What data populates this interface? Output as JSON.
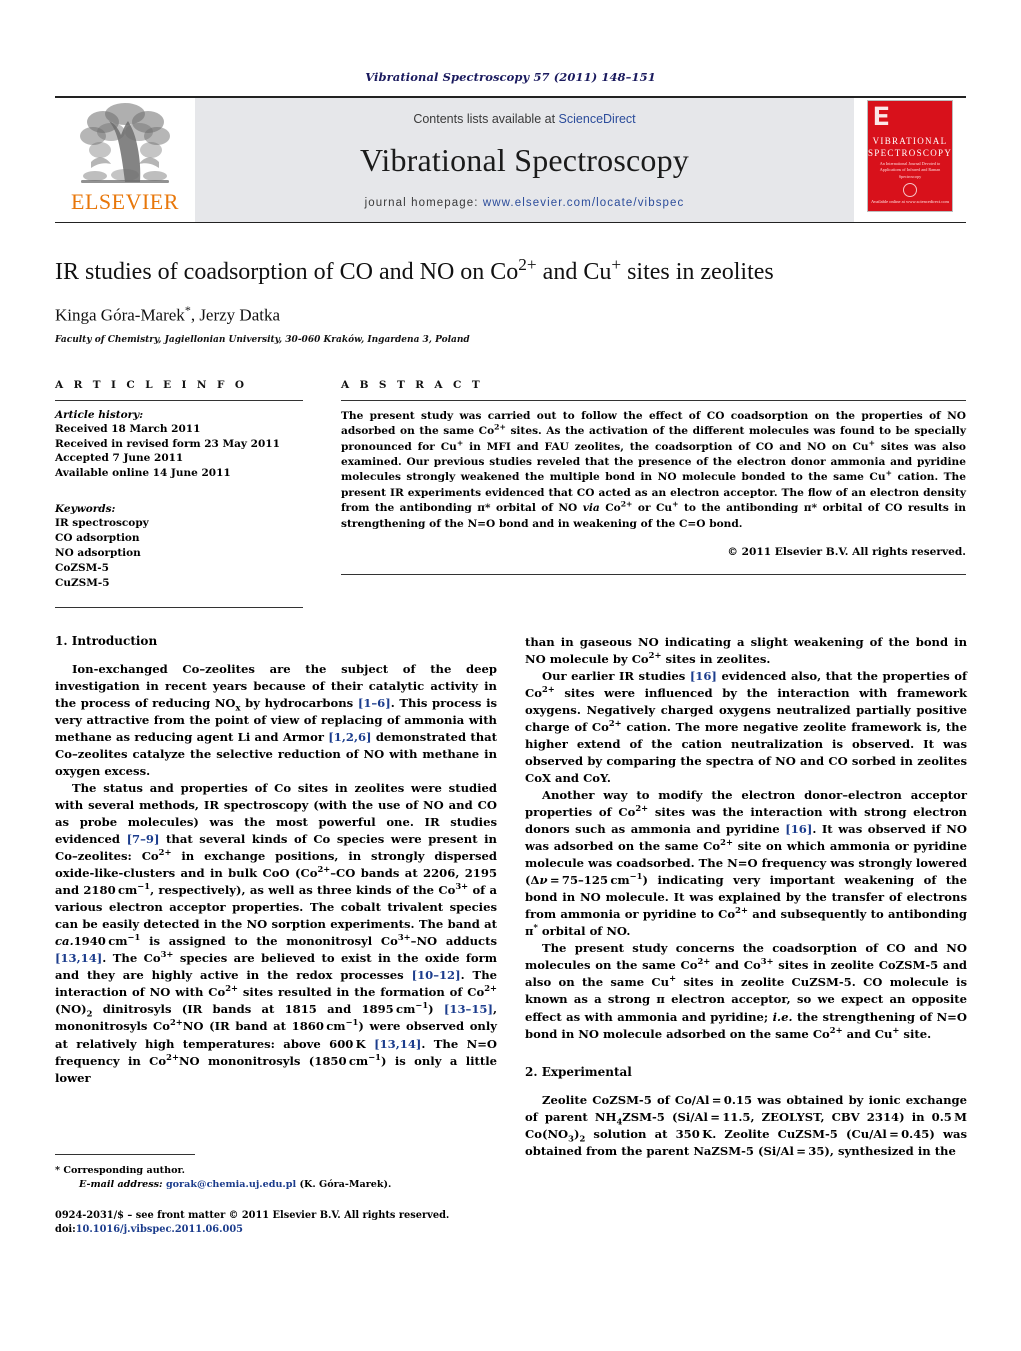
{
  "running_head": "Vibrational Spectroscopy 57 (2011) 148–151",
  "masthead": {
    "contents_prefix": "Contents lists available at",
    "contents_link": "ScienceDirect",
    "journal_title": "Vibrational Spectroscopy",
    "homepage_label": "journal homepage:",
    "homepage_url": "www.elsevier.com/locate/vibspec",
    "publisher_wordmark": "ELSEVIER",
    "cover": {
      "title_line1": "VIBRATIONAL",
      "title_line2": "SPECTROSCOPY",
      "subtitle": "An International Journal Devoted to Applications of Infrared and Raman Spectroscopy",
      "footer": "Available online at www.sciencedirect.com"
    }
  },
  "article": {
    "title": "IR studies of coadsorption of CO and NO on Co2+ and Cu+ sites in zeolites",
    "title_parts": {
      "p1": "IR studies of coadsorption of CO and NO on Co",
      "sup1": "2+",
      "p2": " and Cu",
      "sup2": "+",
      "p3": " sites in zeolites"
    },
    "authors": "Kinga Góra-Marek*, Jerzy Datka",
    "author_names": "Kinga Góra-Marek",
    "author_second": ", Jerzy Datka",
    "affiliation": "Faculty of Chemistry, Jagiellonian University, 30-060 Kraków, Ingardena 3, Poland"
  },
  "info": {
    "heading": "A R T I C L E   I N F O",
    "history_label": "Article history:",
    "history": [
      "Received 18 March 2011",
      "Received in revised form 23 May 2011",
      "Accepted 7 June 2011",
      "Available online 14 June 2011"
    ],
    "keywords_label": "Keywords:",
    "keywords": [
      "IR spectroscopy",
      "CO adsorption",
      "NO adsorption",
      "CoZSM-5",
      "CuZSM-5"
    ]
  },
  "abstract": {
    "heading": "A B S T R A C T",
    "text": "The present study was carried out to follow the effect of CO coadsorption on the properties of NO adsorbed on the same Co2+ sites. As the activation of the different molecules was found to be specially pronounced for Cu+ in MFI and FAU zeolites, the coadsorption of CO and NO on Cu+ sites was also examined. Our previous studies reveled that the presence of the electron donor ammonia and pyridine molecules strongly weakened the multiple bond in NO molecule bonded to the same Cu+ cation. The present IR experiments evidenced that CO acted as an electron acceptor. The flow of an electron density from the antibonding π* orbital of NO via Co2+ or Cu+ to the antibonding π* orbital of CO results in strengthening of the N=O bond and in weakening of the C=O bond.",
    "copyright": "© 2011 Elsevier B.V. All rights reserved."
  },
  "sections": {
    "introduction_heading": "1.  Introduction",
    "experimental_heading": "2.  Experimental"
  },
  "body": {
    "intro_p1": "Ion-exchanged Co–zeolites are the subject of the deep investigation in recent years because of their catalytic activity in the process of reducing NOx by hydrocarbons [1–6]. This process is very attractive from the point of view of replacing of ammonia with methane as reducing agent Li and Armor [1,2,6] demonstrated that Co–zeolites catalyze the selective reduction of NO with methane in oxygen excess.",
    "intro_p2": "The status and properties of Co sites in zeolites were studied with several methods, IR spectroscopy (with the use of NO and CO as probe molecules) was the most powerful one. IR studies evidenced [7–9] that several kinds of Co species were present in Co–zeolites: Co2+ in exchange positions, in strongly dispersed oxide-like-clusters and in bulk CoO (Co2+–CO bands at 2206, 2195 and 2180 cm−1, respectively), as well as three kinds of the Co3+ of a various electron acceptor properties. The cobalt trivalent species can be easily detected in the NO sorption experiments. The band at ca.1940 cm−1 is assigned to the mononitrosyl Co3+–NO adducts [13,14]. The Co3+ species are believed to exist in the oxide form and they are highly active in the redox processes [10–12]. The interaction of NO with Co2+ sites resulted in the formation of Co2+(NO)2 dinitrosyls (IR bands at 1815 and 1895 cm−1) [13–15], mononitrosyls Co2+NO (IR band at 1860 cm−1) were observed only at relatively high temperatures: above 600 K [13,14]. The N=O frequency in Co2+NO mononitrosyls (1850 cm−1) is only a little lower",
    "right_p1": "than in gaseous NO indicating a slight weakening of the bond in NO molecule by Co2+ sites in zeolites.",
    "right_p2": "Our earlier IR studies [16] evidenced also, that the properties of Co2+ sites were influenced by the interaction with framework oxygens. Negatively charged oxygens neutralized partially positive charge of Co2+ cation. The more negative zeolite framework is, the higher extend of the cation neutralization is observed. It was observed by comparing the spectra of NO and CO sorbed in zeolites CoX and CoY.",
    "right_p3": "Another way to modify the electron donor–electron acceptor properties of Co2+ sites was the interaction with strong electron donors such as ammonia and pyridine [16]. It was observed if NO was adsorbed on the same Co2+ site on which ammonia or pyridine molecule was coadsorbed. The N=O frequency was strongly lowered (Δν = 75–125 cm−1) indicating very important weakening of the bond in NO molecule. It was explained by the transfer of electrons from ammonia or pyridine to Co2+ and subsequently to antibonding π* orbital of NO.",
    "right_p4": "The present study concerns the coadsorption of CO and NO molecules on the same Co2+ and Co3+ sites in zeolite CoZSM-5 and also on the same Cu+ sites in zeolite CuZSM-5. CO molecule is known as a strong π electron acceptor, so we expect an opposite effect as with ammonia and pyridine; i.e. the strengthening of N=O bond in NO molecule adsorbed on the same Co2+ and Cu+ site.",
    "exp_p1": "Zeolite CoZSM-5 of Co/Al = 0.15 was obtained by ionic exchange of parent NH4ZSM-5 (Si/Al = 11.5, ZEOLYST, CBV 2314) in 0.5 M Co(NO3)2 solution at 350 K. Zeolite CuZSM-5 (Cu/Al = 0.45) was obtained from the parent NaZSM-5 (Si/Al = 35), synthesized in the"
  },
  "footnotes": {
    "corresponding_marker": "*",
    "corresponding_text": "Corresponding author.",
    "email_label": "E-mail address:",
    "email": "gorak@chemia.uj.edu.pl",
    "email_owner": "(K. Góra-Marek).",
    "issn_line": "0924-2031/$ – see front matter © 2011 Elsevier B.V. All rights reserved.",
    "doi_label": "doi:",
    "doi": "10.1016/j.vibspec.2011.06.005"
  },
  "colors": {
    "link": "#2b4c9b",
    "reference": "#1b3c8c",
    "elsevier_orange": "#e8770a",
    "cover_red": "#d8111b",
    "masthead_grey": "#e6e7ea",
    "running_head": "#1a1a5e"
  }
}
